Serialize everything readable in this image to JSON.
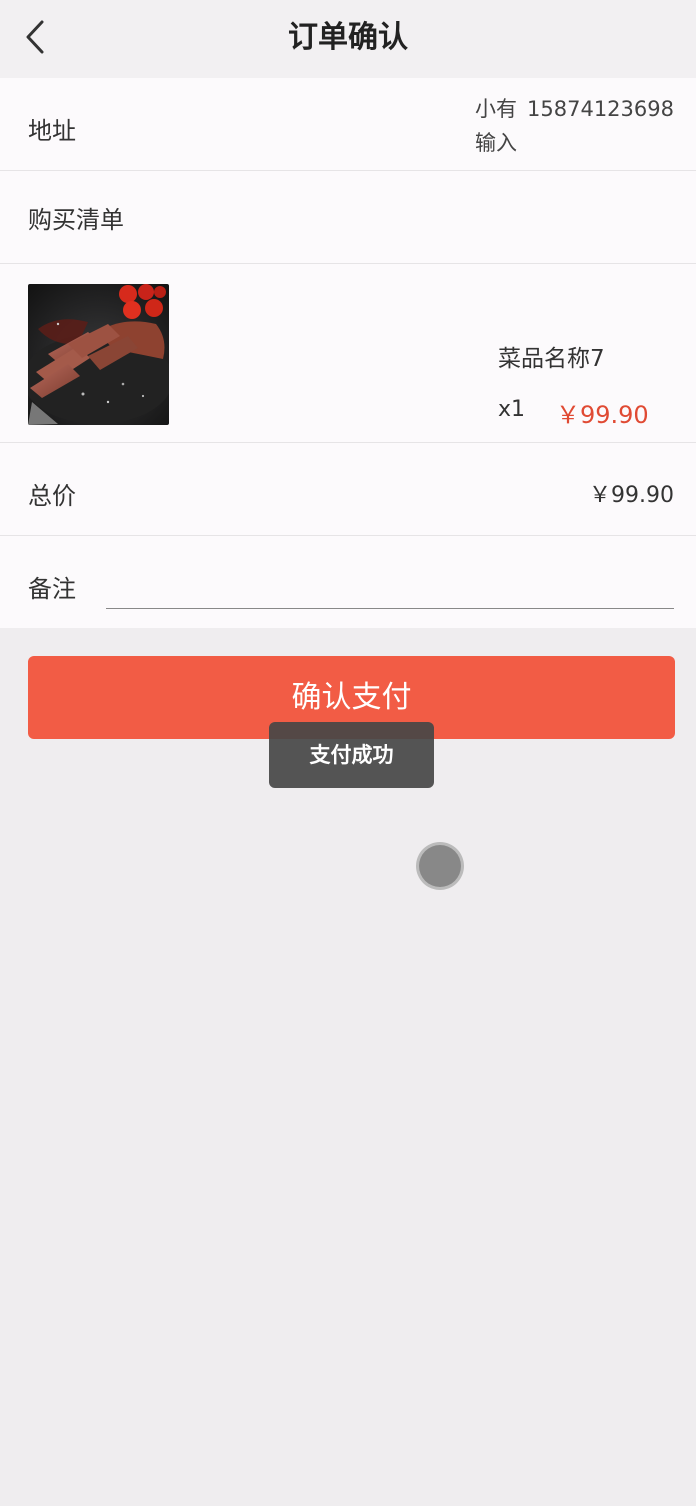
{
  "header": {
    "title": "订单确认",
    "back_icon": "chevron-left-icon"
  },
  "address": {
    "label": "地址",
    "name": "小有",
    "phone": "15874123698",
    "detail": "输入"
  },
  "purchase_list": {
    "label": "购买清单"
  },
  "items": [
    {
      "name": "菜品名称7",
      "quantity": "x1",
      "price": "￥99.90",
      "image": "steak-photo"
    }
  ],
  "total": {
    "label": "总价",
    "value": "￥99.90"
  },
  "note": {
    "label": "备注",
    "value": "",
    "placeholder": ""
  },
  "actions": {
    "pay_label": "确认支付"
  },
  "toast": {
    "message": "支付成功"
  },
  "colors": {
    "accent": "#f25c45",
    "price": "#e04a33",
    "background": "#efedef",
    "card": "#fcfafc"
  }
}
